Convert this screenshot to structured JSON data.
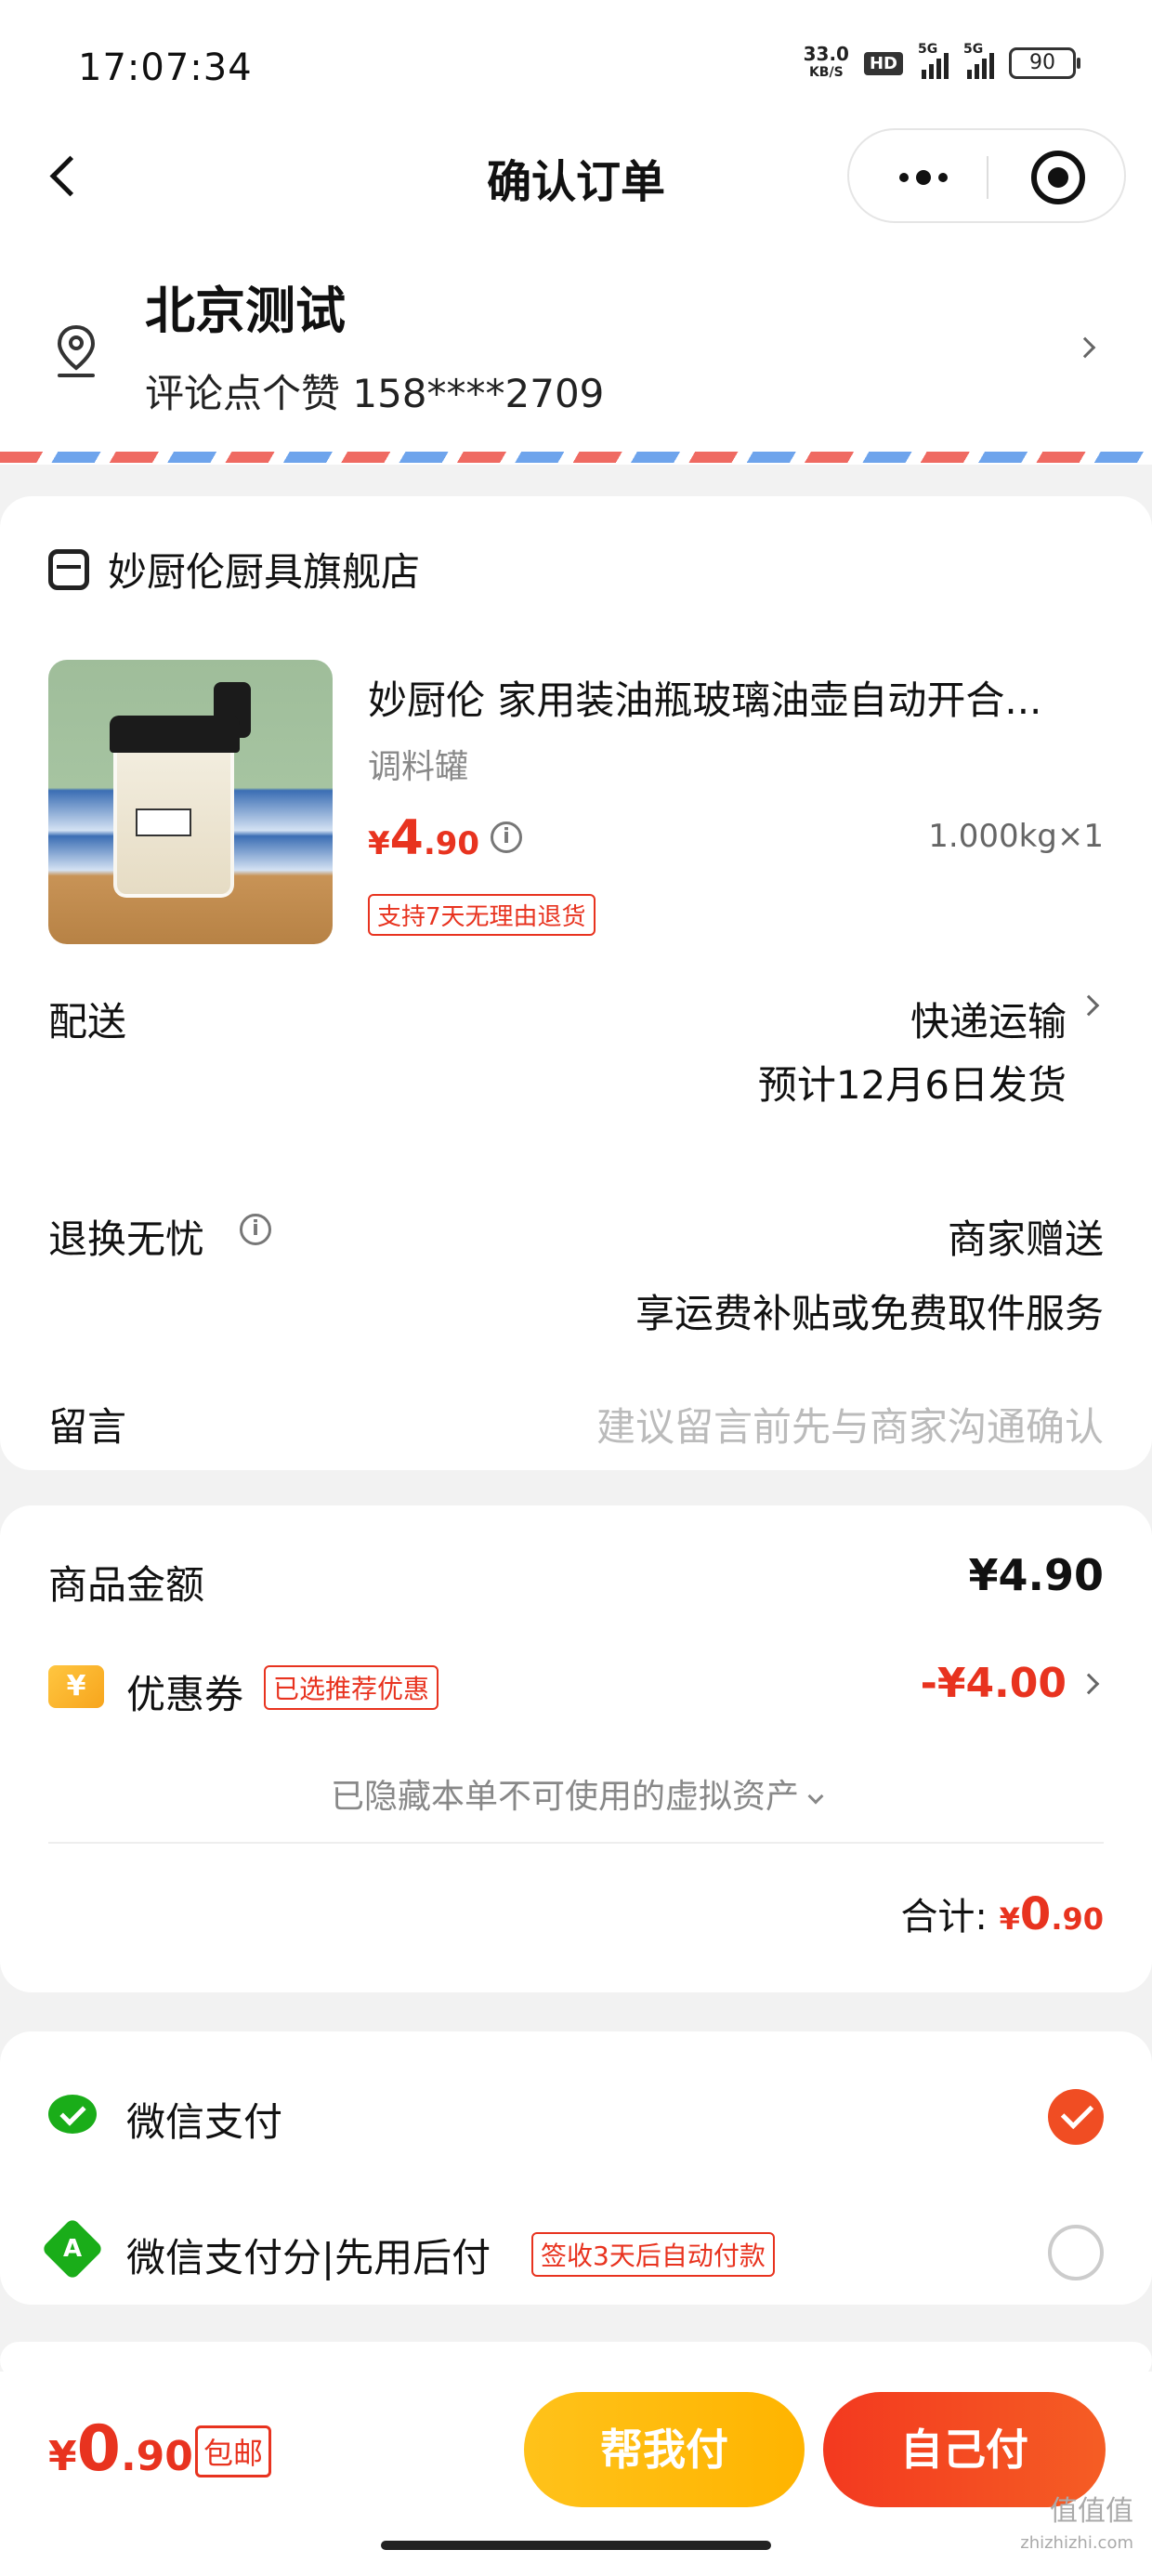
{
  "status_bar": {
    "time": "17:07:34",
    "net_speed": "33.0",
    "net_unit": "KB/S",
    "hd": "HD",
    "signal1": "5G",
    "signal2": "5G",
    "battery": "90"
  },
  "nav": {
    "title": "确认订单"
  },
  "address": {
    "name": "北京测试",
    "contact": "评论点个赞 158****2709"
  },
  "store": {
    "name": "妙厨伦厨具旗舰店"
  },
  "product": {
    "title": "妙厨伦 家用装油瓶玻璃油壶自动开合...",
    "spec": "调料罐",
    "price_symbol": "¥",
    "price_int": "4",
    "price_dec": ".90",
    "qty": "1.000kg×1",
    "return_tag": "支持7天无理由退货"
  },
  "delivery": {
    "label": "配送",
    "method": "快递运输",
    "eta": "预计12月6日发货"
  },
  "returns": {
    "label": "退换无忧",
    "value": "商家赠送",
    "desc": "享运费补贴或免费取件服务"
  },
  "message": {
    "label": "留言",
    "placeholder": "建议留言前先与商家沟通确认"
  },
  "amount": {
    "goods_label": "商品金额",
    "goods_value": "¥4.90",
    "coupon_icon": "¥",
    "coupon_label": "优惠券",
    "coupon_tag": "已选推荐优惠",
    "coupon_value": "-¥4.00",
    "hidden_assets": "已隐藏本单不可使用的虚拟资产",
    "total_label": "合计:",
    "total_symbol": "¥",
    "total_int": "0",
    "total_dec": ".90"
  },
  "payment": {
    "wechat_pay": "微信支付",
    "score_icon": "A",
    "wechat_score": "微信支付分|先用后付",
    "score_tag": "签收3天后自动付款"
  },
  "bottom": {
    "price_symbol": "¥",
    "price_int": "0",
    "price_dec": ".90",
    "free_shipping": "包邮",
    "help_pay": "帮我付",
    "self_pay": "自己付"
  },
  "watermark": {
    "text": "值值值",
    "url": "zhizhizhi.com"
  },
  "colors": {
    "accent_red": "#e8331f",
    "help_button": "#ffb400",
    "self_button": "#f3391f",
    "wechat_green": "#1aad19"
  }
}
